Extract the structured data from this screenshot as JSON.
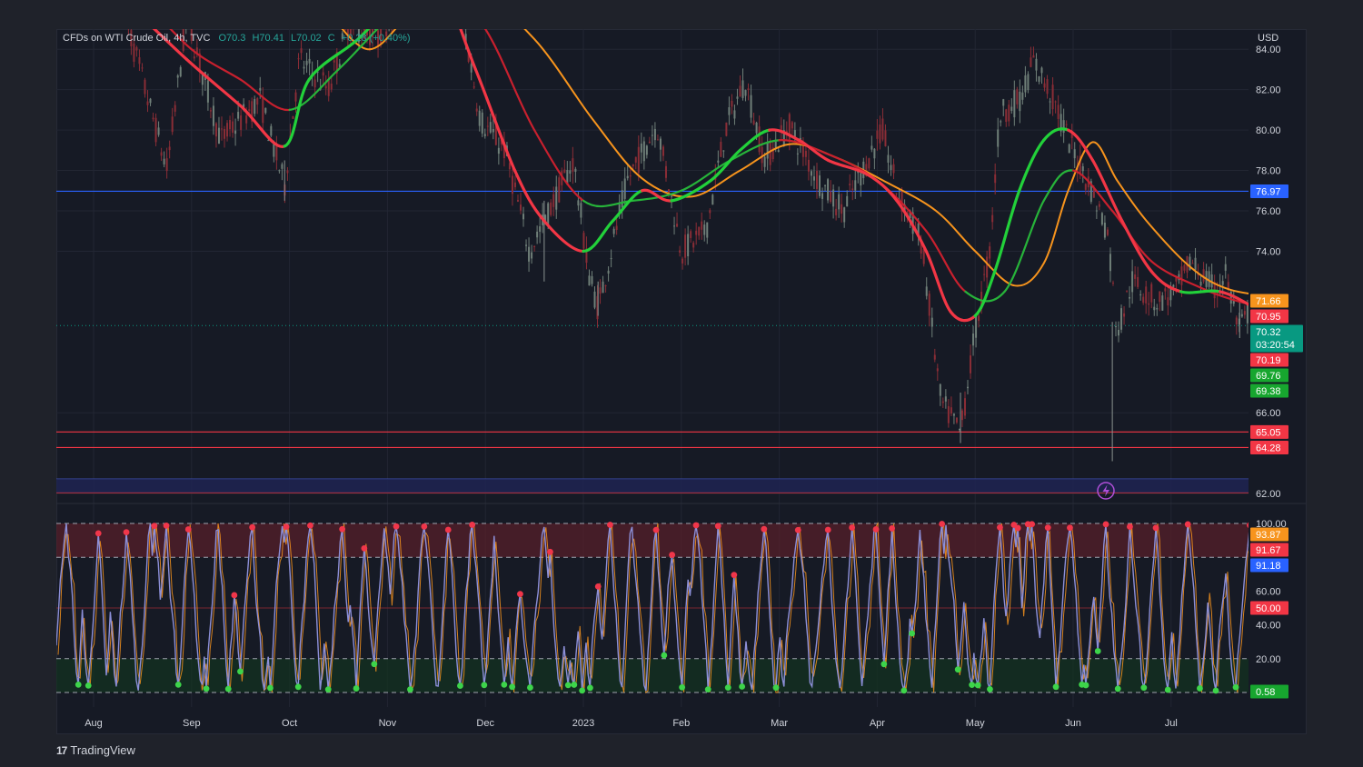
{
  "header": {
    "symbol": "CFDs on WTI Crude Oil, 4h, TVC",
    "ohlc_fragment": "O70.3",
    "high_fragment": "H70.41",
    "low_fragment": "L70.02",
    "close_fragment": "C",
    "change": "+0.28 (+0.40%)"
  },
  "currency": "USD",
  "brand": {
    "logo": "17",
    "name": "TradingView"
  },
  "colors": {
    "background": "#161a25",
    "page": "#1f222a",
    "grid": "#222633",
    "axis_text": "#d1d4dc",
    "bull_green": "#22d13a",
    "bear_red": "#f23645",
    "orange": "#f7941d",
    "blue_line": "#2962ff",
    "osc_line": "#8c8fd8"
  },
  "chart_data": [
    {
      "type": "line",
      "name": "price-panel",
      "title": "CFDs on WTI Crude Oil, 4h, TVC",
      "x_ticks": [
        "Aug",
        "Sep",
        "Oct",
        "Nov",
        "Dec",
        "2023",
        "Feb",
        "Mar",
        "Apr",
        "May",
        "Jun",
        "Jul"
      ],
      "y_ticks": [
        "84.00",
        "82.00",
        "80.00",
        "78.00",
        "76.00",
        "74.00",
        "66.00",
        "62.00"
      ],
      "ylim": [
        61.6,
        85.0
      ],
      "price_path": [
        [
          0.3,
          86.0
        ],
        [
          0.75,
          78.0
        ],
        [
          0.95,
          85.6
        ],
        [
          1.3,
          79.5
        ],
        [
          1.7,
          81.5
        ],
        [
          1.95,
          77.2
        ],
        [
          2.1,
          83.5
        ],
        [
          2.4,
          82.0
        ],
        [
          2.6,
          85.2
        ],
        [
          2.9,
          84.6
        ],
        [
          3.2,
          87.0
        ],
        [
          3.5,
          88.0
        ],
        [
          3.75,
          86.0
        ],
        [
          3.95,
          80.5
        ],
        [
          4.2,
          79.0
        ],
        [
          4.45,
          74.0
        ],
        [
          4.65,
          76.0
        ],
        [
          4.9,
          78.5
        ],
        [
          5.05,
          73.0
        ],
        [
          5.15,
          71.2
        ],
        [
          5.45,
          77.5
        ],
        [
          5.75,
          80.3
        ],
        [
          6.0,
          74.0
        ],
        [
          6.25,
          75.0
        ],
        [
          6.45,
          80.0
        ],
        [
          6.65,
          82.5
        ],
        [
          6.85,
          78.5
        ],
        [
          7.1,
          80.2
        ],
        [
          7.4,
          77.5
        ],
        [
          7.65,
          76.0
        ],
        [
          7.85,
          78.0
        ],
        [
          8.05,
          80.0
        ],
        [
          8.2,
          77.0
        ],
        [
          8.45,
          74.5
        ],
        [
          8.65,
          66.5
        ],
        [
          8.85,
          65.0
        ],
        [
          9.0,
          70.0
        ],
        [
          9.15,
          74.0
        ],
        [
          9.25,
          80.8
        ],
        [
          9.45,
          81.5
        ],
        [
          9.6,
          83.4
        ],
        [
          9.8,
          81.5
        ],
        [
          9.95,
          79.5
        ],
        [
          10.15,
          77.5
        ],
        [
          10.35,
          75.0
        ],
        [
          10.45,
          70.0
        ],
        [
          10.6,
          72.5
        ],
        [
          10.85,
          71.5
        ],
        [
          11.05,
          72.0
        ],
        [
          11.2,
          73.5
        ],
        [
          11.45,
          72.0
        ],
        [
          11.55,
          73.0
        ],
        [
          11.7,
          70.0
        ],
        [
          11.9,
          72.3
        ],
        [
          12.05,
          70.0
        ],
        [
          12.15,
          70.3
        ]
      ],
      "price_wicks": [
        [
          1.95,
          76.5,
          78.5
        ],
        [
          4.6,
          72.5,
          76.5
        ],
        [
          5.15,
          70.8,
          72.5
        ],
        [
          8.85,
          64.5,
          67.0
        ],
        [
          10.4,
          63.6,
          70.5
        ],
        [
          11.7,
          69.7,
          71.5
        ],
        [
          11.95,
          73.3,
          74.8
        ],
        [
          12.1,
          69.2,
          71.0
        ]
      ],
      "moving_averages": [
        {
          "role": "fast",
          "points": [
            [
              0.3,
              86.5
            ],
            [
              0.95,
              83.5
            ],
            [
              1.5,
              81.2
            ],
            [
              1.95,
              79.2
            ],
            [
              2.2,
              82.5
            ],
            [
              2.7,
              84.5
            ],
            [
              3.1,
              86.5
            ],
            [
              3.5,
              87.5
            ],
            [
              3.9,
              83.0
            ],
            [
              4.3,
              78.0
            ],
            [
              4.6,
              75.5
            ],
            [
              5.0,
              74.0
            ],
            [
              5.3,
              75.5
            ],
            [
              5.6,
              77.0
            ],
            [
              5.9,
              76.5
            ],
            [
              6.3,
              77.5
            ],
            [
              6.6,
              79.0
            ],
            [
              6.9,
              80.0
            ],
            [
              7.2,
              79.5
            ],
            [
              7.5,
              78.5
            ],
            [
              7.9,
              77.8
            ],
            [
              8.2,
              76.5
            ],
            [
              8.5,
              74.0
            ],
            [
              8.75,
              71.0
            ],
            [
              9.0,
              70.8
            ],
            [
              9.2,
              73.0
            ],
            [
              9.45,
              77.0
            ],
            [
              9.7,
              79.5
            ],
            [
              9.95,
              80.0
            ],
            [
              10.2,
              78.5
            ],
            [
              10.5,
              75.5
            ],
            [
              10.8,
              73.0
            ],
            [
              11.1,
              72.0
            ],
            [
              11.5,
              72.0
            ],
            [
              11.85,
              71.2
            ],
            [
              12.15,
              70.2
            ]
          ]
        },
        {
          "role": "mid",
          "points": [
            [
              0.5,
              86.5
            ],
            [
              1.0,
              84.0
            ],
            [
              1.5,
              82.5
            ],
            [
              2.0,
              81.0
            ],
            [
              2.5,
              83.0
            ],
            [
              3.0,
              85.5
            ],
            [
              3.5,
              87.5
            ],
            [
              4.0,
              85.0
            ],
            [
              4.5,
              80.0
            ],
            [
              5.0,
              76.5
            ],
            [
              5.5,
              76.5
            ],
            [
              6.0,
              77.0
            ],
            [
              6.5,
              78.5
            ],
            [
              7.0,
              79.5
            ],
            [
              7.5,
              78.8
            ],
            [
              8.0,
              77.5
            ],
            [
              8.5,
              75.0
            ],
            [
              8.9,
              72.0
            ],
            [
              9.3,
              72.0
            ],
            [
              9.7,
              76.5
            ],
            [
              10.0,
              78.0
            ],
            [
              10.4,
              76.0
            ],
            [
              10.8,
              73.5
            ],
            [
              11.3,
              72.2
            ],
            [
              11.7,
              71.5
            ],
            [
              12.15,
              71.0
            ]
          ]
        },
        {
          "role": "slow",
          "points": [
            [
              2.3,
              86.5
            ],
            [
              2.8,
              84.0
            ],
            [
              3.3,
              86.0
            ],
            [
              3.9,
              86.8
            ],
            [
              4.5,
              84.5
            ],
            [
              5.1,
              80.5
            ],
            [
              5.6,
              77.6
            ],
            [
              6.1,
              76.7
            ],
            [
              6.6,
              78.0
            ],
            [
              7.1,
              79.3
            ],
            [
              7.6,
              78.6
            ],
            [
              8.1,
              77.4
            ],
            [
              8.6,
              76.0
            ],
            [
              9.0,
              74.0
            ],
            [
              9.4,
              72.3
            ],
            [
              9.7,
              73.4
            ],
            [
              9.95,
              77.0
            ],
            [
              10.2,
              79.4
            ],
            [
              10.45,
              77.5
            ],
            [
              10.75,
              75.5
            ],
            [
              11.2,
              73.2
            ],
            [
              11.6,
              72.1
            ],
            [
              12.15,
              71.7
            ]
          ]
        }
      ],
      "horizontal_levels": [
        {
          "value": 76.97,
          "label": "76.97",
          "color": "#2962ff"
        },
        {
          "value": 65.05,
          "label": "65.05",
          "color": "#f23645"
        },
        {
          "value": 64.28,
          "label": "64.28",
          "color": "#f23645"
        },
        {
          "value": 62.72,
          "label": "",
          "color": "#3a4aa8"
        },
        {
          "value": 62.05,
          "label": "",
          "color": "#f23645"
        }
      ],
      "price_badges": [
        {
          "value": 71.66,
          "label": "71.66",
          "color": "#f7941d"
        },
        {
          "value": 70.95,
          "label": "70.95",
          "color": "#f23645"
        },
        {
          "value": 70.32,
          "label": "70.32",
          "sublabel": "03:20:54",
          "color": "#089981"
        },
        {
          "value": 70.19,
          "label": "70.19",
          "color": "#f23645"
        },
        {
          "value": 69.76,
          "label": "69.76",
          "color": "#17a62f"
        },
        {
          "value": 69.38,
          "label": "69.38",
          "color": "#17a62f"
        }
      ]
    },
    {
      "type": "line",
      "name": "oscillator-panel",
      "y_ticks": [
        "100.00",
        "60.00",
        "40.00",
        "20.00"
      ],
      "ylim": [
        -1,
        101
      ],
      "bands": [
        {
          "from": 80,
          "to": 100,
          "color": "#5a1f2a"
        },
        {
          "from": 0,
          "to": 20,
          "color": "#12331f"
        }
      ],
      "dashed_levels": [
        100,
        80,
        20,
        0
      ],
      "mid_level": 50,
      "value_badges": [
        {
          "value": 93.87,
          "label": "93.87",
          "color": "#f7941d"
        },
        {
          "value": 91.67,
          "label": "91.67",
          "color": "#f23645"
        },
        {
          "value": 91.18,
          "label": "91.18",
          "color": "#2962ff"
        },
        {
          "value": 50.0,
          "label": "50.00",
          "color": "#f23645"
        },
        {
          "value": 0.58,
          "label": "0.58",
          "color": "#17a62f"
        }
      ]
    }
  ]
}
